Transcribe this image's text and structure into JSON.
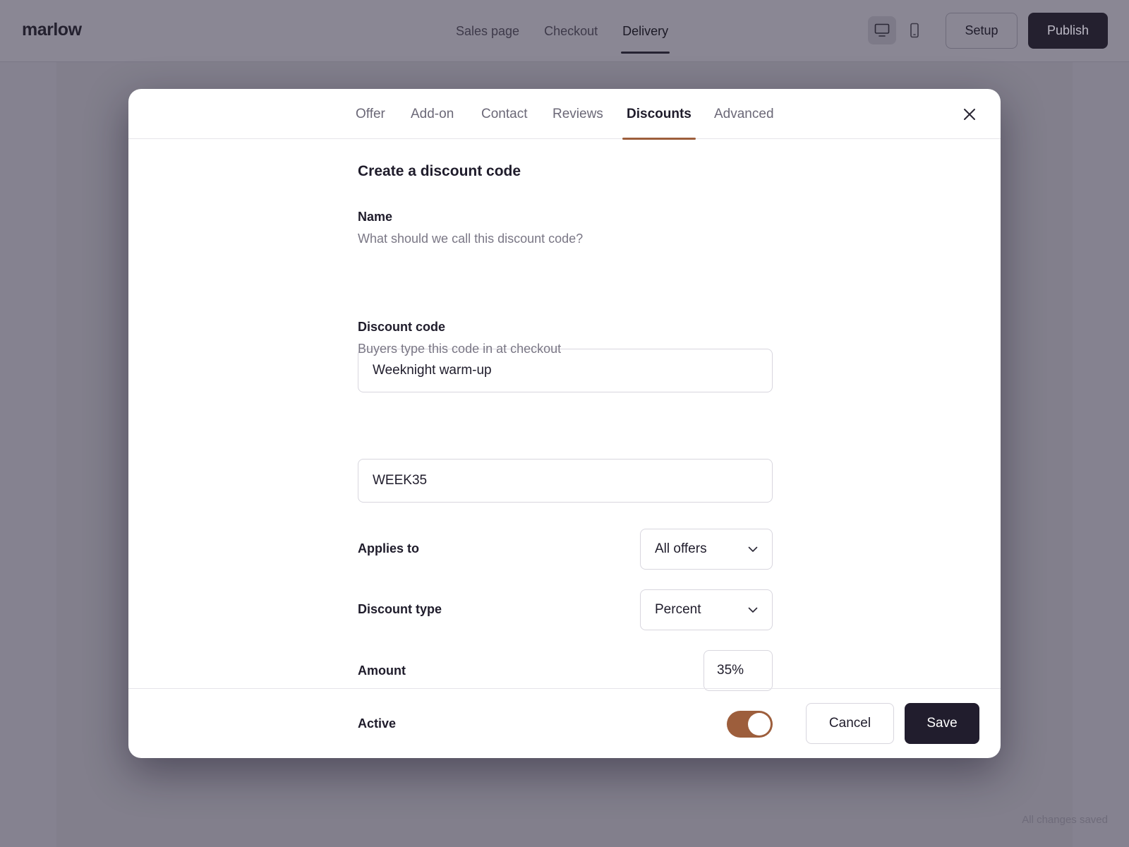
{
  "app": {
    "logo": "marlow",
    "nav": [
      {
        "label": "Sales page",
        "active": false
      },
      {
        "label": "Checkout",
        "active": false
      },
      {
        "label": "Delivery",
        "active": true
      }
    ],
    "device_icons": [
      "desktop-icon",
      "mobile-icon"
    ],
    "setup_label": "Setup",
    "publish_label": "Publish",
    "status": "All changes saved"
  },
  "modal": {
    "tabs": [
      {
        "label": "Offer",
        "active": false
      },
      {
        "label": "Add-on",
        "active": false
      },
      {
        "label": "Contact",
        "active": false
      },
      {
        "label": "Reviews",
        "active": false
      },
      {
        "label": "Discounts",
        "active": true
      },
      {
        "label": "Advanced",
        "active": false
      }
    ],
    "close_icon": "close-icon",
    "title": "Create a discount code",
    "name": {
      "label": "Name",
      "hint": "What should we call this discount code?",
      "value": "Weeknight warm-up"
    },
    "code": {
      "label": "Discount code",
      "hint": "Buyers type this code in at checkout",
      "value": "WEEK35"
    },
    "applies_to": {
      "label": "Applies to",
      "value": "All offers"
    },
    "discount_type": {
      "label": "Discount type",
      "value": "Percent"
    },
    "amount": {
      "label": "Amount",
      "value": "35%"
    },
    "active": {
      "label": "Active",
      "on": true
    },
    "cancel_label": "Cancel",
    "save_label": "Save"
  },
  "colors": {
    "accent": "#9d5e3c",
    "primary_dark": "#211d2d",
    "overlay": "#858290"
  }
}
